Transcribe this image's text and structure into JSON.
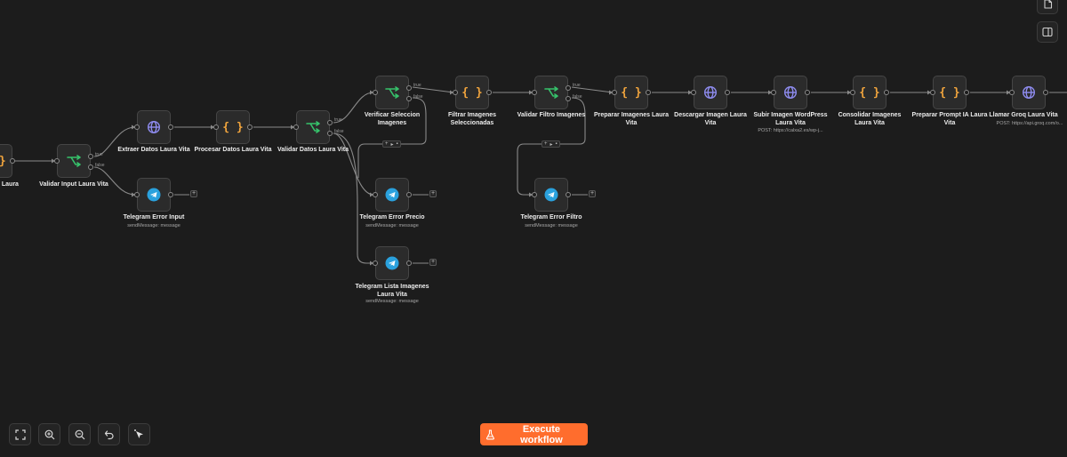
{
  "colors": {
    "background": "#1c1c1c",
    "node_bg": "#2b2b2b",
    "if_icon": "#36c26b",
    "code_icon": "#f2a53d",
    "http_icon": "#8f8cf0",
    "telegram_icon": "#2aa1dd",
    "accent": "#ff6d2d"
  },
  "workflow": {
    "branch_true": "true",
    "branch_false": "false",
    "nodes": [
      {
        "id": "input",
        "type": "code",
        "icon": "braces-icon",
        "label": "put Laura",
        "sub": ""
      },
      {
        "id": "validar-input",
        "type": "if",
        "icon": "branch-icon",
        "label": "Validar Input Laura Vita",
        "sub": ""
      },
      {
        "id": "extraer-datos",
        "type": "http",
        "icon": "globe-icon",
        "label": "Extraer Datos Laura Vita",
        "sub": ""
      },
      {
        "id": "procesar-datos",
        "type": "code",
        "icon": "braces-icon",
        "label": "Procesar Datos Laura Vita",
        "sub": ""
      },
      {
        "id": "validar-datos",
        "type": "if",
        "icon": "branch-icon",
        "label": "Validar Datos Laura Vita",
        "sub": ""
      },
      {
        "id": "verificar-seleccion",
        "type": "if",
        "icon": "branch-icon",
        "label": "Verificar Seleccion Imagenes",
        "sub": ""
      },
      {
        "id": "filtrar-imagenes",
        "type": "code",
        "icon": "braces-icon",
        "label": "Filtrar Imagenes Seleccionadas",
        "sub": ""
      },
      {
        "id": "validar-filtro",
        "type": "if",
        "icon": "branch-icon",
        "label": "Validar Filtro Imagenes",
        "sub": ""
      },
      {
        "id": "preparar-imagenes",
        "type": "code",
        "icon": "braces-icon",
        "label": "Preparar Imagenes Laura Vita",
        "sub": ""
      },
      {
        "id": "descargar-imagen",
        "type": "http",
        "icon": "globe-icon",
        "label": "Descargar Imagen Laura Vita",
        "sub": ""
      },
      {
        "id": "subir-imagen",
        "type": "http",
        "icon": "globe-icon",
        "label": "Subir Imagen WordPress Laura Vita",
        "sub": "POST: https://calxa2.es/wp-j..."
      },
      {
        "id": "consolidar-imagenes",
        "type": "code",
        "icon": "braces-icon",
        "label": "Consolidar Imagenes Laura Vita",
        "sub": ""
      },
      {
        "id": "preparar-prompt",
        "type": "code",
        "icon": "braces-icon",
        "label": "Preparar Prompt IA Laura Vita",
        "sub": ""
      },
      {
        "id": "llamar-groq",
        "type": "http",
        "icon": "globe-icon",
        "label": "Llamar Groq Laura Vita",
        "sub": "POST: https://api.groq.com/o..."
      },
      {
        "id": "telegram-error-input",
        "type": "telegram",
        "icon": "telegram-icon",
        "label": "Telegram Error Input",
        "sub": "sendMessage: message"
      },
      {
        "id": "telegram-error-precio",
        "type": "telegram",
        "icon": "telegram-icon",
        "label": "Telegram Error Precio",
        "sub": "sendMessage: message"
      },
      {
        "id": "telegram-lista-imagenes",
        "type": "telegram",
        "icon": "telegram-icon",
        "label": "Telegram Lista Imagenes Laura Vita",
        "sub": "sendMessage: message"
      },
      {
        "id": "telegram-error-filtro",
        "type": "telegram",
        "icon": "telegram-icon",
        "label": "Telegram Error Filtro",
        "sub": "sendMessage: message"
      }
    ]
  },
  "controls": {
    "execute_label": "Execute workflow",
    "fit_icon": "fit-view-icon",
    "zoom_in_icon": "zoom-in-icon",
    "zoom_out_icon": "zoom-out-icon",
    "undo_icon": "undo-icon",
    "tidy_icon": "cursor-sparkle-icon",
    "sticky_icon": "sticky-note-icon",
    "panel_icon": "panel-toggle-icon",
    "flask_icon": "flask-icon"
  }
}
